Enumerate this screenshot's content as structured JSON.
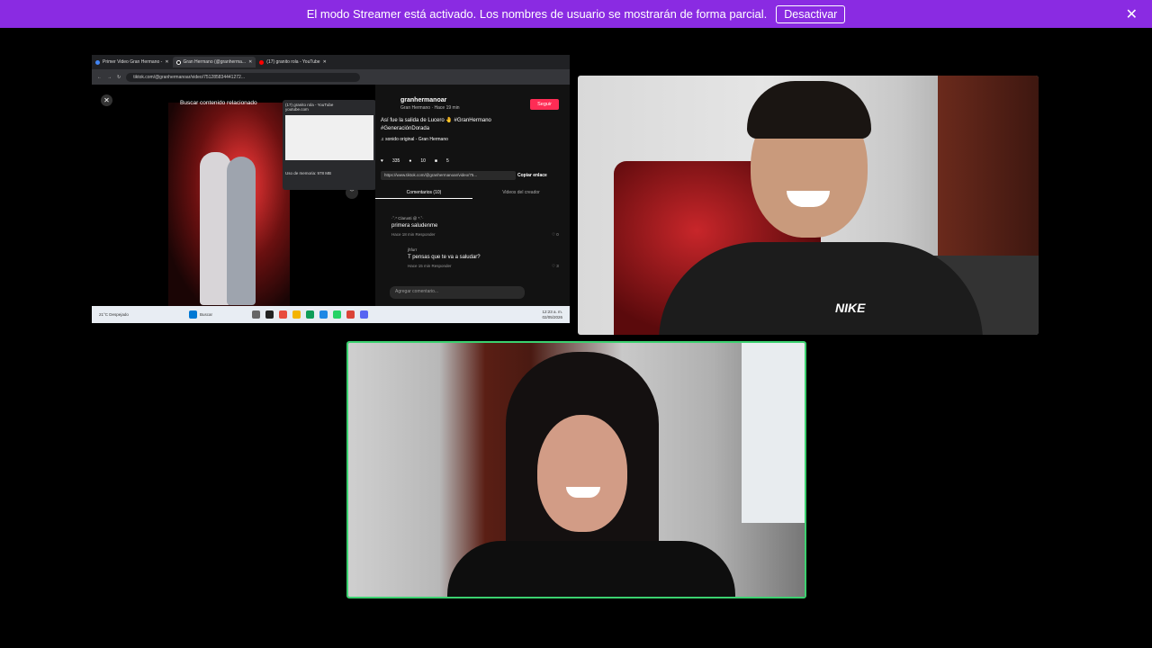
{
  "banner": {
    "message": "El modo Streamer está activado. Los nombres de usuario se mostrarán de forma parcial.",
    "deactivate_label": "Desactivar",
    "close_symbol": "✕",
    "color": "#8a2be2"
  },
  "screenshare": {
    "tabs": [
      {
        "label": "Primer Video Gran Hermano -",
        "close": "✕"
      },
      {
        "label": "Gran Hermano (@granherma...",
        "close": "✕"
      },
      {
        "label": "(17) granito rola - YouTube",
        "close": "✕"
      }
    ],
    "address": "tiktok.com/@granhermanoar/video/751285834441272...",
    "search_hint": "Buscar contenido relacionado",
    "popup": {
      "title": "(17) granito rola - YouTube",
      "site": "youtube.com",
      "memory": "Uso de memoria: 978 MB"
    },
    "post": {
      "username": "granhermanoar",
      "meta": "Gran Hermano · Hace 19 min",
      "follow_label": "Seguir",
      "caption": "Así fue la salida de Lucero 🤚 #GranHermano #GeneraciónDorada",
      "sound": "♫ sonido original - Gran Hermano",
      "likes": "335",
      "comments_count": "10",
      "saves": "5",
      "link": "https://www.tiktok.com/@granhermanoar/video/75...",
      "copy_label": "Copiar enlace",
      "tab_comments": "Comentarios (10)",
      "tab_creator": "Videos del creador",
      "comment1_user": "·˚.* Clarusti @ *.˚·",
      "comment1_text": "primera saludenme",
      "comment1_meta": "Hace 18 min   Responder",
      "comment1_likes": "♡ 0",
      "comment2_user": "jhfurr",
      "comment2_text": "T pensas que te va a saludar?",
      "comment2_meta": "Hace 15 min   Responder",
      "comment2_likes": "♡ 3",
      "comment_placeholder": "Agregar comentario..."
    },
    "taskbar": {
      "weather": "21°C Despejado",
      "search": "Buscar",
      "time": "12:23 a. m.",
      "date": "02/05/2026"
    }
  },
  "participants": {
    "cam1_brand": "NIKE",
    "speaking_border_color": "#3bd16f"
  }
}
